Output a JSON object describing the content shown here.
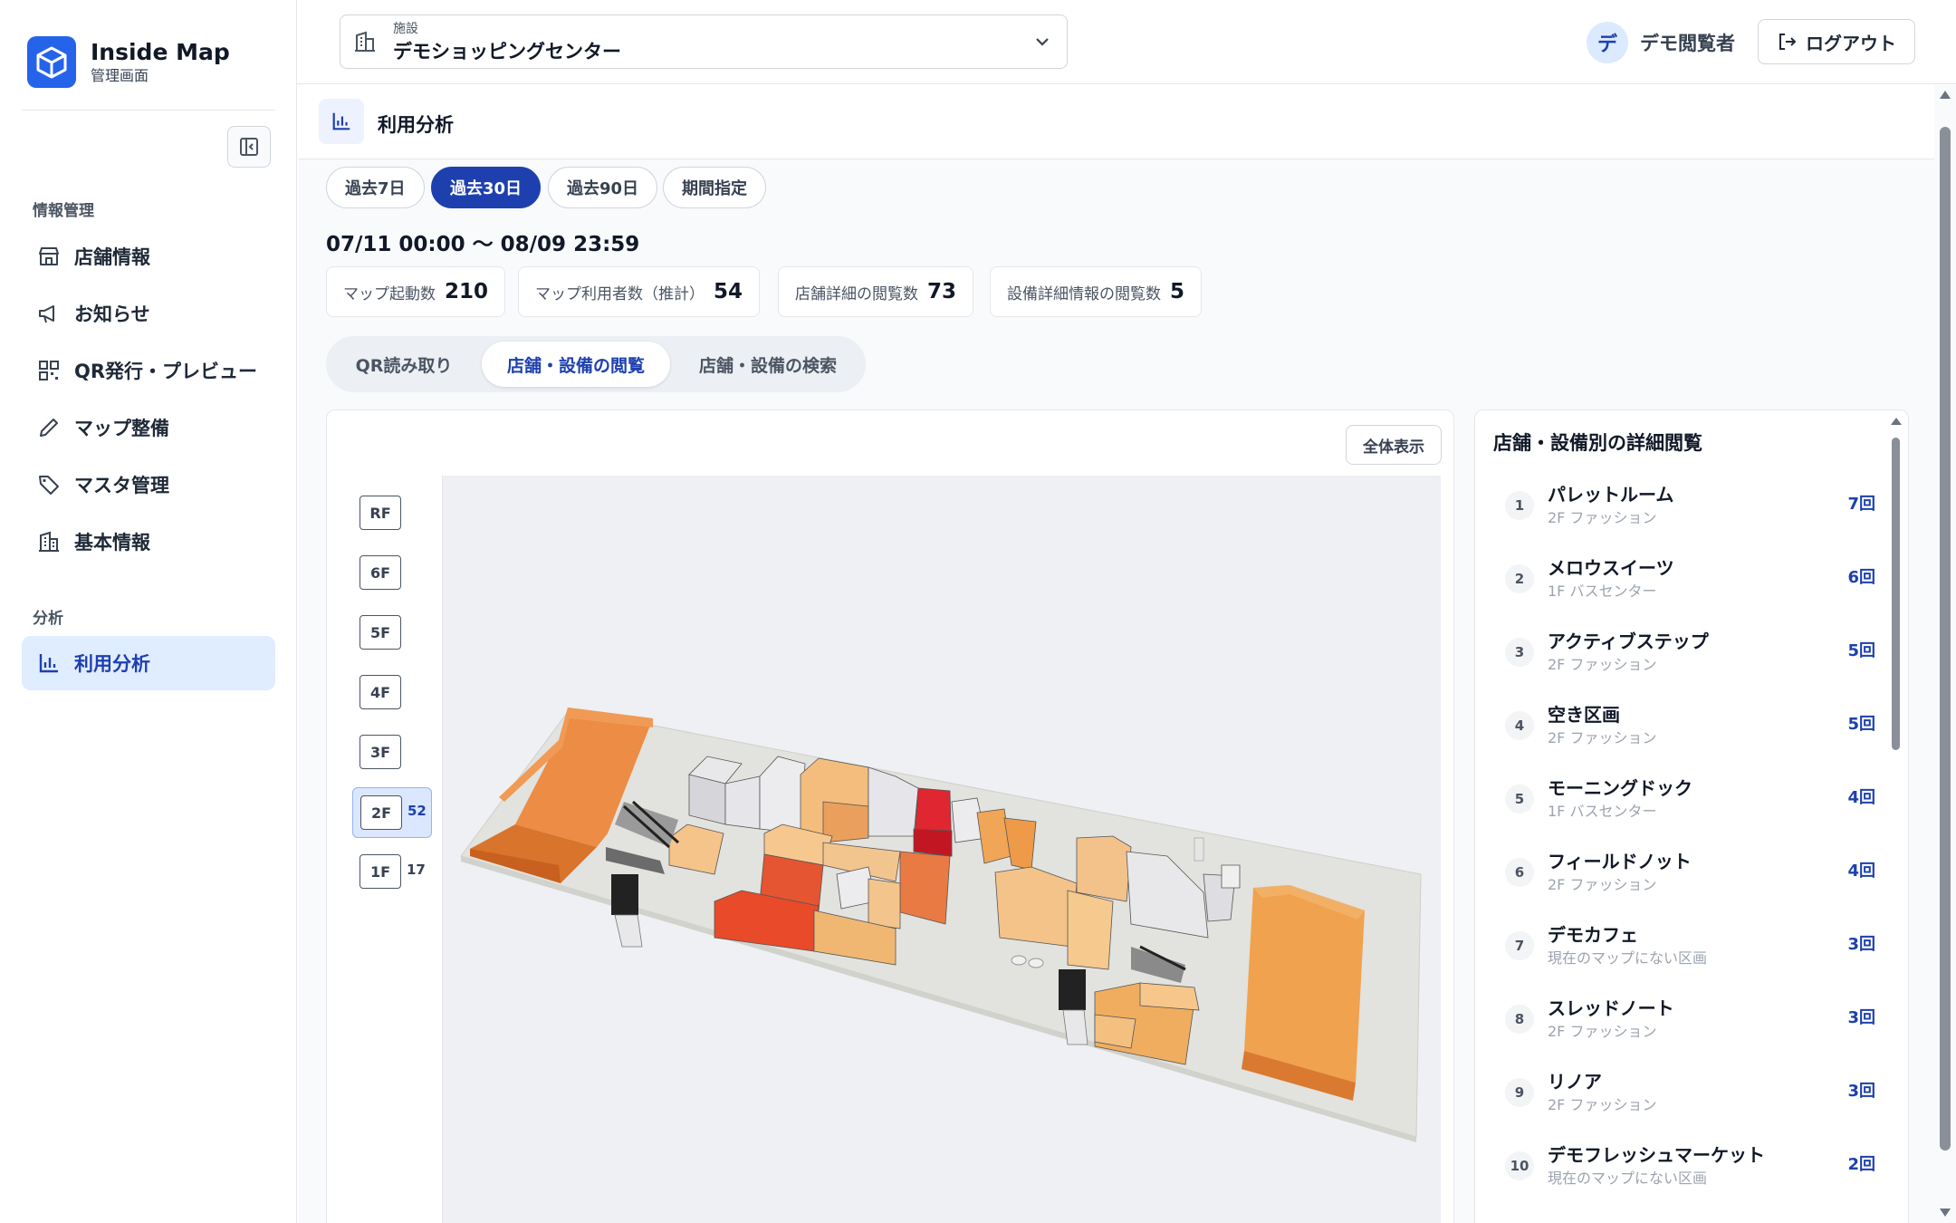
{
  "brand": {
    "name": "Inside Map",
    "sub": "管理画面"
  },
  "sidebar": {
    "section1": "情報管理",
    "section2": "分析",
    "items": [
      {
        "label": "店舗情報",
        "icon": "store-icon"
      },
      {
        "label": "お知らせ",
        "icon": "megaphone-icon"
      },
      {
        "label": "QR発行・プレビュー",
        "icon": "qr-icon"
      },
      {
        "label": "マップ整備",
        "icon": "pencil-icon"
      },
      {
        "label": "マスタ管理",
        "icon": "tag-icon"
      },
      {
        "label": "基本情報",
        "icon": "building-icon"
      }
    ],
    "analysis_item": {
      "label": "利用分析",
      "icon": "bar-chart-icon"
    }
  },
  "header": {
    "facility_label": "施設",
    "facility_value": "デモショッピングセンター",
    "user_initial": "デ",
    "user_name": "デモ閲覧者",
    "logout": "ログアウト"
  },
  "page": {
    "title": "利用分析",
    "periods": [
      "過去7日",
      "過去30日",
      "過去90日",
      "期間指定"
    ],
    "active_period": "過去30日",
    "range": "07/11 00:00 〜 08/09 23:59",
    "stats": [
      {
        "label": "マップ起動数",
        "value": "210"
      },
      {
        "label": "マップ利用者数（推計）",
        "value": "54"
      },
      {
        "label": "店舗詳細の閲覧数",
        "value": "73"
      },
      {
        "label": "設備詳細情報の閲覧数",
        "value": "5"
      }
    ],
    "tabs": [
      "QR読み取り",
      "店舗・設備の閲覧",
      "店舗・設備の検索"
    ],
    "active_tab": "店舗・設備の閲覧"
  },
  "map": {
    "fit_button": "全体表示",
    "floors": [
      {
        "label": "RF",
        "count": ""
      },
      {
        "label": "6F",
        "count": ""
      },
      {
        "label": "5F",
        "count": ""
      },
      {
        "label": "4F",
        "count": ""
      },
      {
        "label": "3F",
        "count": ""
      },
      {
        "label": "2F",
        "count": "52"
      },
      {
        "label": "1F",
        "count": "17"
      }
    ],
    "active_floor": "2F"
  },
  "ranking": {
    "title": "店舗・設備別の詳細閲覧",
    "items": [
      {
        "rank": "1",
        "name": "パレットルーム",
        "sub": "2F ファッション",
        "count": "7回"
      },
      {
        "rank": "2",
        "name": "メロウスイーツ",
        "sub": "1F バスセンター",
        "count": "6回"
      },
      {
        "rank": "3",
        "name": "アクティブステップ",
        "sub": "2F ファッション",
        "count": "5回"
      },
      {
        "rank": "4",
        "name": "空き区画",
        "sub": "2F ファッション",
        "count": "5回"
      },
      {
        "rank": "5",
        "name": "モーニングドック",
        "sub": "1F バスセンター",
        "count": "4回"
      },
      {
        "rank": "6",
        "name": "フィールドノット",
        "sub": "2F ファッション",
        "count": "4回"
      },
      {
        "rank": "7",
        "name": "デモカフェ",
        "sub": "現在のマップにない区画",
        "count": "3回"
      },
      {
        "rank": "8",
        "name": "スレッドノート",
        "sub": "2F ファッション",
        "count": "3回"
      },
      {
        "rank": "9",
        "name": "リノア",
        "sub": "2F ファッション",
        "count": "3回"
      },
      {
        "rank": "10",
        "name": "デモフレッシュマーケット",
        "sub": "現在のマップにない区画",
        "count": "2回"
      }
    ]
  },
  "colors": {
    "accent": "#1e40af",
    "brand": "#2563eb",
    "heat_high": "#d9262c",
    "heat_mid": "#ee8a3f",
    "heat_low": "#f4c98c"
  }
}
